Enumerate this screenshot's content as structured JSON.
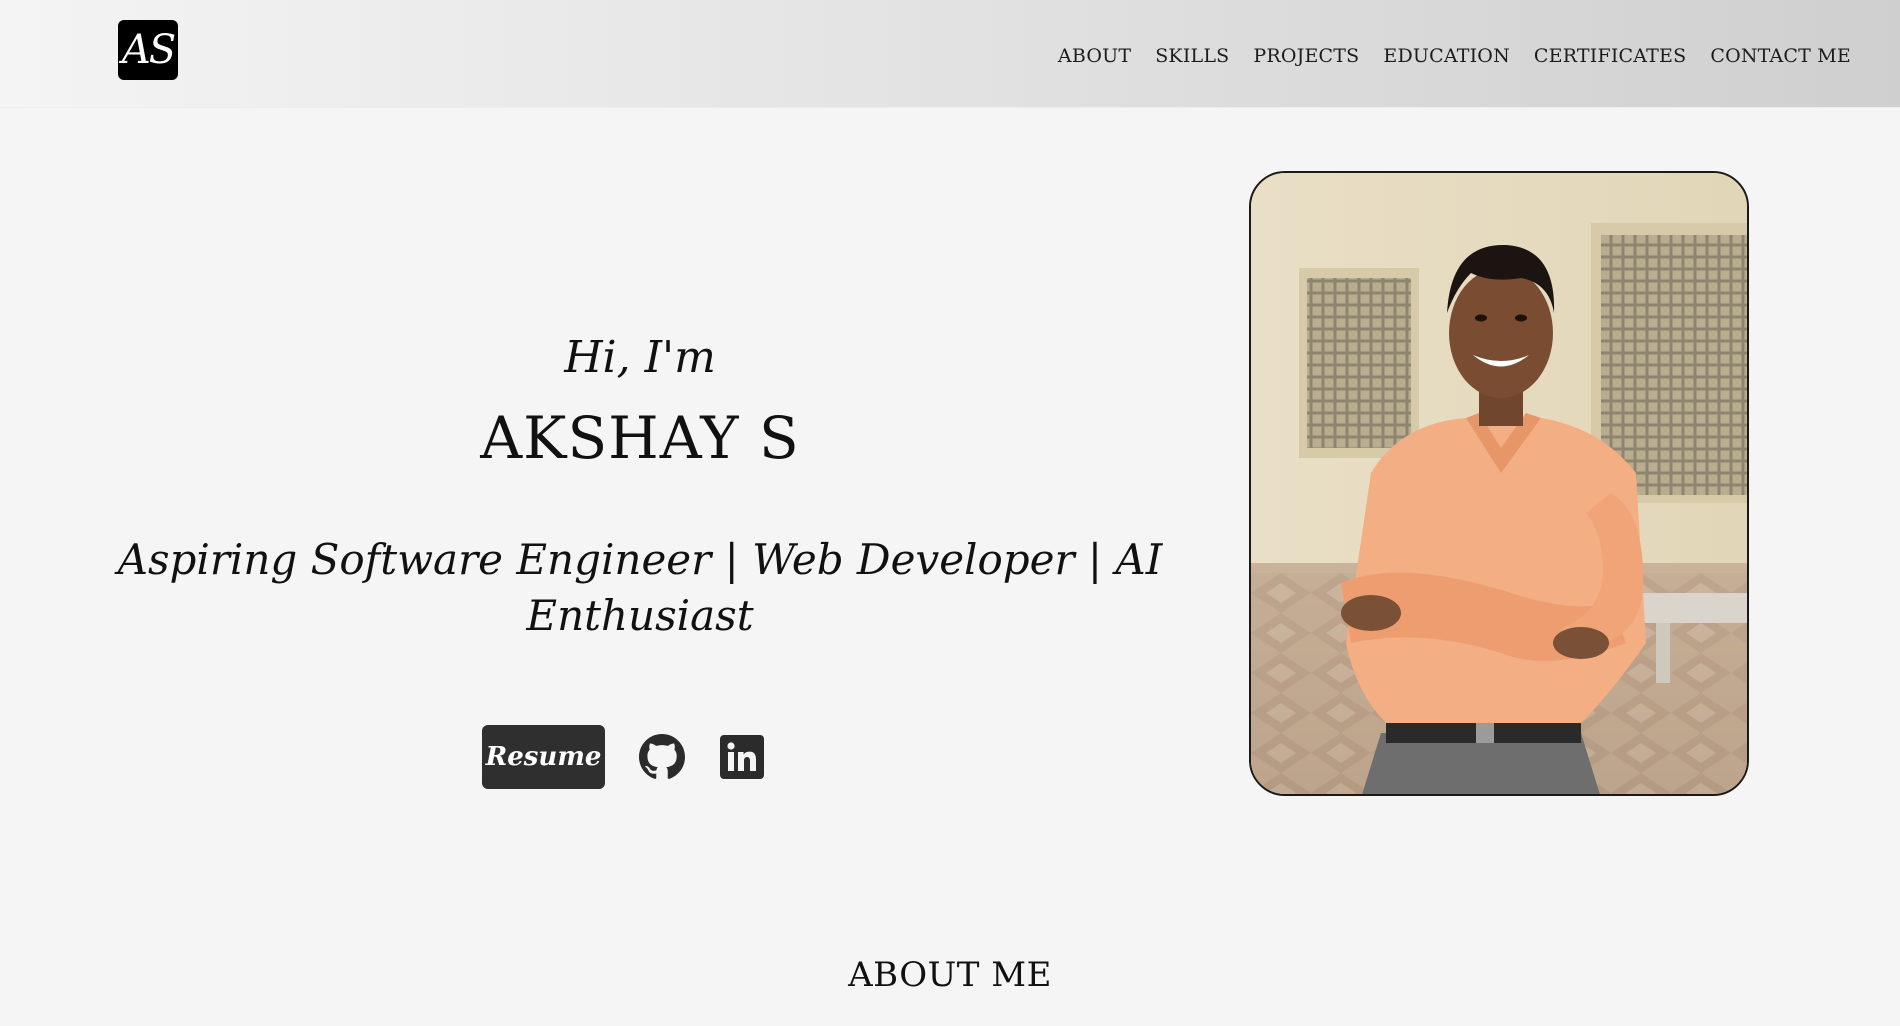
{
  "header": {
    "logo_text": "AS",
    "nav": [
      {
        "label": "ABOUT"
      },
      {
        "label": "SKILLS"
      },
      {
        "label": "PROJECTS"
      },
      {
        "label": "EDUCATION"
      },
      {
        "label": "CERTIFICATES"
      },
      {
        "label": "CONTACT ME"
      }
    ]
  },
  "hero": {
    "greeting": "Hi, I'm",
    "name": "AKSHAY S",
    "tagline": "Aspiring Software Engineer | Web Developer | AI Enthusiast",
    "resume_label": "Resume",
    "icons": [
      "github-icon",
      "linkedin-icon"
    ]
  },
  "about": {
    "title": "ABOUT ME"
  },
  "colors": {
    "button_bg": "#2f2f2f",
    "text": "#111111",
    "header_gradient_start": "#f4f4f4",
    "header_gradient_end": "#cfcfcf",
    "page_bg": "#f5f5f5"
  }
}
